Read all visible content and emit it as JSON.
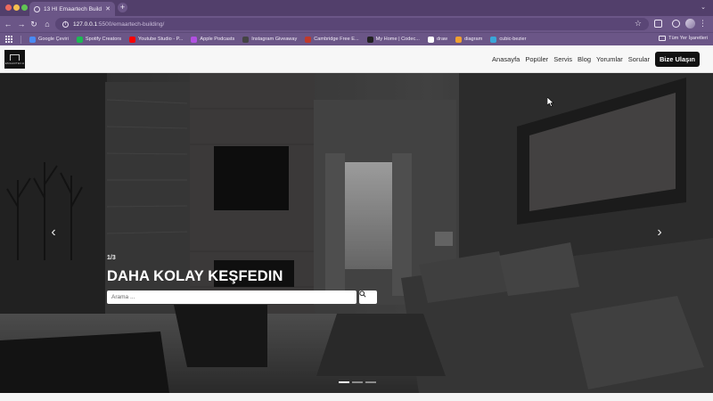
{
  "browser": {
    "tab_title": "13 HI Emaartech Building",
    "url_host": "127.0.0.1",
    "url_path": ":5500/emaartech-building/",
    "bookmarks": [
      {
        "label": "Google Çeviri",
        "color": "#4a8af4"
      },
      {
        "label": "Spotify Creators",
        "color": "#1db954"
      },
      {
        "label": "Youtube Studio - P...",
        "color": "#ff0000"
      },
      {
        "label": "Apple Podcasts",
        "color": "#b150e2"
      },
      {
        "label": "Instagram Giveaway",
        "color": "#444444"
      },
      {
        "label": "Cambridge Free E...",
        "color": "#c0392b"
      },
      {
        "label": "My Home | Codec...",
        "color": "#222222"
      },
      {
        "label": "draw",
        "color": "#ffffff"
      },
      {
        "label": "diagram",
        "color": "#f0a030"
      },
      {
        "label": "cubic-bezier",
        "color": "#3aa6d8"
      }
    ],
    "other_bookmarks": "Tüm Yer İşaretleri"
  },
  "site": {
    "logo_text": "EMAARTECH",
    "nav": [
      {
        "label": "Anasayfa"
      },
      {
        "label": "Popüler"
      },
      {
        "label": "Servis"
      },
      {
        "label": "Blog"
      },
      {
        "label": "Yorumlar"
      },
      {
        "label": "Sorular"
      }
    ],
    "cta": "Bize Ulaşın"
  },
  "hero": {
    "slide_counter": "1/3",
    "title": "DAHA KOLAY KEŞFEDIN",
    "search_placeholder": "Arama ...",
    "slides": 3,
    "active_slide": 1
  },
  "colors": {
    "browser_frame": "#6b5687",
    "cta_bg": "#111111"
  }
}
